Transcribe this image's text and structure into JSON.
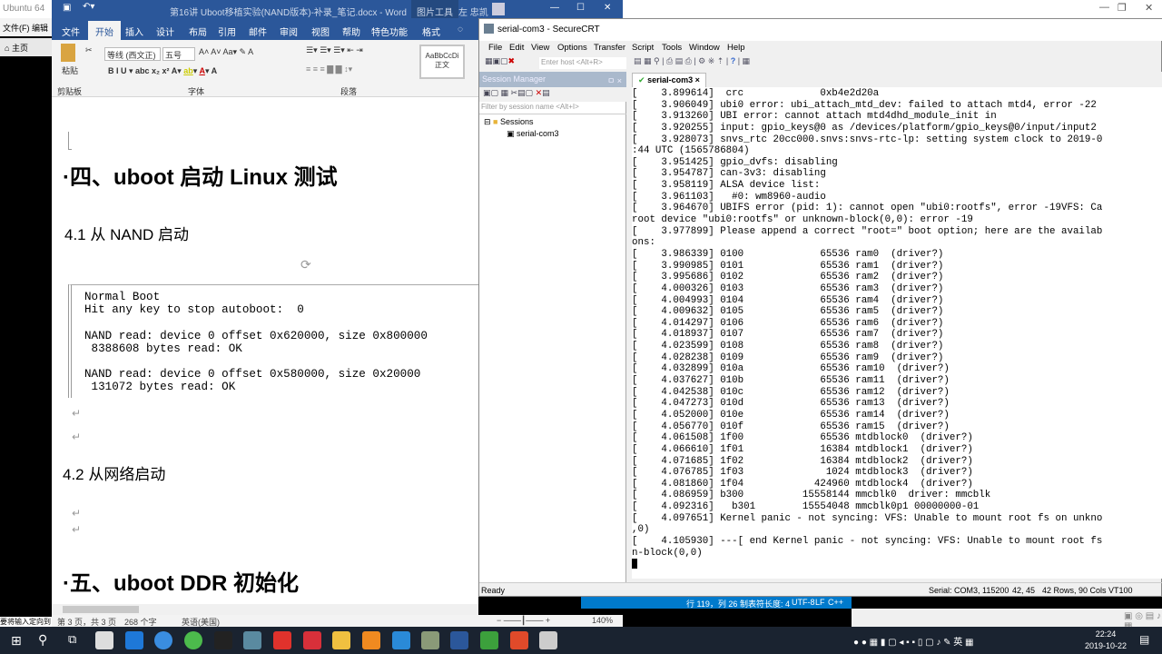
{
  "vm": {
    "title": "Ubuntu 64",
    "menu": "文件(F)  编辑",
    "home_tab": "主页",
    "hint": "要将输入定向到"
  },
  "word": {
    "title": "第16讲 Uboot移植实验(NAND版本)-补录_笔记.docx  -  Word",
    "picture_tools": "图片工具",
    "user": "左 忠凯",
    "tabs": [
      "文件",
      "开始",
      "插入",
      "设计",
      "布局",
      "引用",
      "邮件",
      "审阅",
      "视图",
      "帮助",
      "特色功能",
      "格式"
    ],
    "active_tab": "开始",
    "ribbon": {
      "paste": "粘贴",
      "clipboard": "剪贴板",
      "font_name": "等线 (西文正)",
      "font_size": "五号",
      "font_group": "字体",
      "paragraph_group": "段落",
      "style_preview": "AaBbCcDi",
      "style_name": "正文"
    },
    "doc": {
      "h1": "·四、uboot 启动 Linux 测试",
      "h2a": "4.1  从 NAND 启动",
      "code": [
        "Normal Boot",
        "Hit any key to stop autoboot:  0",
        "",
        "NAND read: device 0 offset 0x620000, size 0x800000",
        " 8388608 bytes read: OK",
        "",
        "NAND read: device 0 offset 0x580000, size 0x20000",
        " 131072 bytes read: OK"
      ],
      "h2b": "4.2  从网络启动",
      "h1b": "·五、uboot DDR 初始化",
      "para_mark": "↵"
    },
    "status": {
      "page": "第 3 页，共 3 页",
      "words": "268 个字",
      "lang": "英语(美国)",
      "zoom": "140%"
    }
  },
  "crt": {
    "title": "serial-com3 - SecureCRT",
    "menu": [
      "File",
      "Edit",
      "View",
      "Options",
      "Transfer",
      "Script",
      "Tools",
      "Window",
      "Help"
    ],
    "host_placeholder": "Enter host <Alt+R>",
    "session_manager": "Session Manager",
    "filter_placeholder": "Filter by session name <Alt+I>",
    "tree": {
      "root": "Sessions",
      "child": "serial-com3"
    },
    "tab": "serial-com3",
    "terminal": [
      "[    3.899614]  crc             0xb4e2d20a",
      "[    3.906049] ubi0 error: ubi_attach_mtd_dev: failed to attach mtd4, error -22",
      "[    3.913260] UBI error: cannot attach mtd4dhd_module_init in",
      "[    3.920255] input: gpio_keys@0 as /devices/platform/gpio_keys@0/input/input2",
      "[    3.928073] snvs_rtc 20cc000.snvs:snvs-rtc-lp: setting system clock to 2019-0",
      ":44 UTC (1565786804)",
      "[    3.951425] gpio_dvfs: disabling",
      "[    3.954787] can-3v3: disabling",
      "[    3.958119] ALSA device list:",
      "[    3.961103]   #0: wm8960-audio",
      "[    3.964670] UBIFS error (pid: 1): cannot open \"ubi0:rootfs\", error -19VFS: Ca",
      "root device \"ubi0:rootfs\" or unknown-block(0,0): error -19",
      "[    3.977899] Please append a correct \"root=\" boot option; here are the availab",
      "ons:",
      "[    3.986339] 0100             65536 ram0  (driver?)",
      "[    3.990985] 0101             65536 ram1  (driver?)",
      "[    3.995686] 0102             65536 ram2  (driver?)",
      "[    4.000326] 0103             65536 ram3  (driver?)",
      "[    4.004993] 0104             65536 ram4  (driver?)",
      "[    4.009632] 0105             65536 ram5  (driver?)",
      "[    4.014297] 0106             65536 ram6  (driver?)",
      "[    4.018937] 0107             65536 ram7  (driver?)",
      "[    4.023599] 0108             65536 ram8  (driver?)",
      "[    4.028238] 0109             65536 ram9  (driver?)",
      "[    4.032899] 010a             65536 ram10  (driver?)",
      "[    4.037627] 010b             65536 ram11  (driver?)",
      "[    4.042538] 010c             65536 ram12  (driver?)",
      "[    4.047273] 010d             65536 ram13  (driver?)",
      "[    4.052000] 010e             65536 ram14  (driver?)",
      "[    4.056770] 010f             65536 ram15  (driver?)",
      "[    4.061508] 1f00             65536 mtdblock0  (driver?)",
      "[    4.066610] 1f01             16384 mtdblock1  (driver?)",
      "[    4.071685] 1f02             16384 mtdblock2  (driver?)",
      "[    4.076785] 1f03              1024 mtdblock3  (driver?)",
      "[    4.081860] 1f04            424960 mtdblock4  (driver?)",
      "[    4.086959] b300          15558144 mmcblk0  driver: mmcblk",
      "[    4.092316]   b301        15554048 mmcblk0p1 00000000-01",
      "[    4.097651] Kernel panic - not syncing: VFS: Unable to mount root fs on unkno",
      ",0)",
      "[    4.105930] ---[ end Kernel panic - not syncing: VFS: Unable to mount root fs",
      "n-block(0,0)"
    ],
    "status": {
      "ready": "Ready",
      "serial": "Serial: COM3, 115200",
      "pos": "42,  45",
      "size": "42 Rows, 90 Cols",
      "emu": "VT100"
    }
  },
  "vscode": {
    "pos": "行 119，列 26",
    "tab": "制表符长度: 4",
    "enc": "UTF-8",
    "eol": "LF",
    "lang": "C++"
  },
  "taskbar": {
    "time": "22:24",
    "date": "2019-10-22",
    "ime": "英"
  }
}
